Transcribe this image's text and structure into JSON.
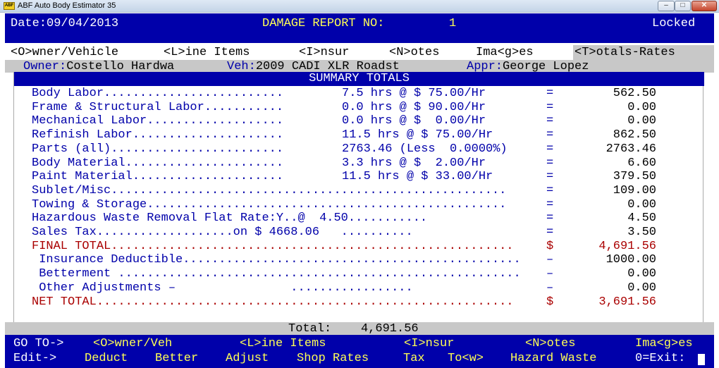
{
  "window": {
    "title": "ABF Auto Body Estimator 35",
    "icon": "abf-app-icon",
    "icon_text": "ABF",
    "min_glyph": "–",
    "max_glyph": "□",
    "close_glyph": "✕"
  },
  "header": {
    "date": "Date:09/04/2013",
    "report_label": "DAMAGE REPORT NO:",
    "report_no": "1",
    "status": "Locked"
  },
  "tabs": [
    {
      "label": "<O>wner/Vehicle"
    },
    {
      "label": "<L>ine Items"
    },
    {
      "label": "<I>nsur"
    },
    {
      "label": "<N>otes"
    },
    {
      "label": "Ima<g>es"
    },
    {
      "label": "<T>otals-Rates"
    }
  ],
  "info": {
    "owner_label": "Owner:",
    "owner": "Costello Hardwa",
    "veh_label": "Veh:",
    "veh": "2009 CADI XLR Roadst",
    "appr_label": "Appr:",
    "appr": "George Lopez"
  },
  "summary": {
    "title": "SUMMARY TOTALS",
    "rows": [
      {
        "label": "Body Labor.........................",
        "calc": "7.5 hrs @ $ 75.00/Hr",
        "eq": "=",
        "amount": "562.50"
      },
      {
        "label": "Frame & Structural Labor...........",
        "calc": "0.0 hrs @ $ 90.00/Hr",
        "eq": "=",
        "amount": "0.00"
      },
      {
        "label": "Mechanical Labor...................",
        "calc": "0.0 hrs @ $  0.00/Hr",
        "eq": "=",
        "amount": "0.00"
      },
      {
        "label": "Refinish Labor.....................",
        "calc": "11.5 hrs @ $ 75.00/Hr",
        "eq": "=",
        "amount": "862.50"
      },
      {
        "label": "Parts (all)........................",
        "calc": "2763.46 (Less  0.0000%)",
        "eq": "=",
        "amount": "2763.46"
      },
      {
        "label": "Body Material......................",
        "calc": "3.3 hrs @ $  2.00/Hr",
        "eq": "=",
        "amount": "6.60"
      },
      {
        "label": "Paint Material.....................",
        "calc": "11.5 hrs @ $ 33.00/Hr",
        "eq": "=",
        "amount": "379.50"
      },
      {
        "label": "Sublet/Misc.......................................................",
        "calc": "",
        "eq": "=",
        "amount": "109.00"
      },
      {
        "label": "Towing & Storage..................................................",
        "calc": "",
        "eq": "=",
        "amount": "0.00"
      },
      {
        "label": "Hazardous Waste Removal Flat Rate:Y..@  4.50...........",
        "calc": "",
        "eq": "=",
        "amount": "4.50"
      },
      {
        "label": "Sales Tax...................on $ 4668.06   ..........",
        "calc": "",
        "eq": "=",
        "amount": "3.50"
      },
      {
        "label": "FINAL TOTAL........................................................",
        "calc": "",
        "eq": "$",
        "amount": "4,691.56",
        "style": "red"
      },
      {
        "label": " Insurance Deductible...............................................",
        "calc": "",
        "eq": "–",
        "amount": "1000.00"
      },
      {
        "label": " Betterment ........................................................",
        "calc": "",
        "eq": "–",
        "amount": "0.00"
      },
      {
        "label": " Other Adjustments –                .................",
        "calc": "",
        "eq": "–",
        "amount": "0.00"
      },
      {
        "label": "NET TOTAL..........................................................",
        "calc": "",
        "eq": "$",
        "amount": "3,691.56",
        "style": "red"
      }
    ]
  },
  "totals": {
    "label": "Total:",
    "value": "4,691.56"
  },
  "footer": {
    "goto_label": "GO TO->",
    "goto_items": [
      "<O>wner/Veh",
      "<L>ine Items",
      "<I>nsur",
      "<N>otes",
      "Ima<g>es"
    ],
    "edit_label": "Edit->",
    "edit_items": [
      "Deduct",
      "Better",
      "Adjust",
      "Shop Rates",
      "Tax",
      "To<w>",
      "Hazard Waste"
    ],
    "exit": "0=Exit:"
  },
  "colors": {
    "blue": "#0000aa",
    "red": "#aa0000",
    "yellow": "#ffff55",
    "grey": "#c8c8c8"
  }
}
